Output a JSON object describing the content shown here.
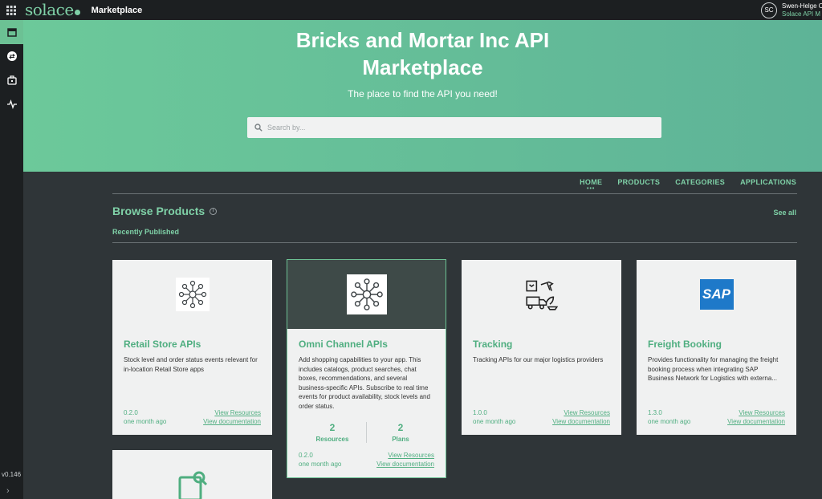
{
  "topbar": {
    "logo": "solace",
    "app_title": "Marketplace",
    "user_initials": "SC",
    "user_name": "Swen-Helge C",
    "user_role": "Solace API M"
  },
  "sidebar": {
    "version": "v0.146"
  },
  "hero": {
    "title_line1": "Bricks and Mortar Inc API",
    "title_line2": "Marketplace",
    "subtitle": "The place to find the API you need!",
    "search_placeholder": "Search by..."
  },
  "nav": {
    "home": "HOME",
    "products": "PRODUCTS",
    "categories": "CATEGORIES",
    "applications": "APPLICATIONS",
    "active_dots": "•••"
  },
  "browse": {
    "title": "Browse Products",
    "see_all": "See all",
    "recent": "Recently Published"
  },
  "cards": [
    {
      "title": "Retail Store APIs",
      "description": "Stock level and order status events relevant for in-location Retail Store apps",
      "version": "0.2.0",
      "published": "one month ago",
      "link_resources": "View Resources",
      "link_docs": "View documentation",
      "icon": "network-hub-icon"
    },
    {
      "title": "Omni Channel APIs",
      "description": "Add shopping capabilities to your app. This includes catalogs, product searches, chat boxes, recommendations, and several business-specific APIs. Subscribe to real time events for product availability, stock levels and order status.",
      "resources_count": "2",
      "resources_label": "Resources",
      "plans_count": "2",
      "plans_label": "Plans",
      "version": "0.2.0",
      "published": "one month ago",
      "link_resources": "View Resources",
      "link_docs": "View documentation",
      "icon": "network-hub-icon"
    },
    {
      "title": "Tracking",
      "description": "Tracking APIs for our major logistics providers",
      "version": "1.0.0",
      "published": "one month ago",
      "link_resources": "View Resources",
      "link_docs": "View documentation",
      "icon": "logistics-icon"
    },
    {
      "title": "Freight Booking",
      "description": "Provides functionality for managing the freight booking process when integrating SAP Business Network for Logistics with externa...",
      "version": "1.3.0",
      "published": "one month ago",
      "link_resources": "View Resources",
      "link_docs": "View documentation",
      "icon_text": "SAP"
    }
  ],
  "colors": {
    "accent": "#7fd1a7",
    "hero": "#6cc99a",
    "background": "#2f3538",
    "card": "#f0f1f1"
  }
}
